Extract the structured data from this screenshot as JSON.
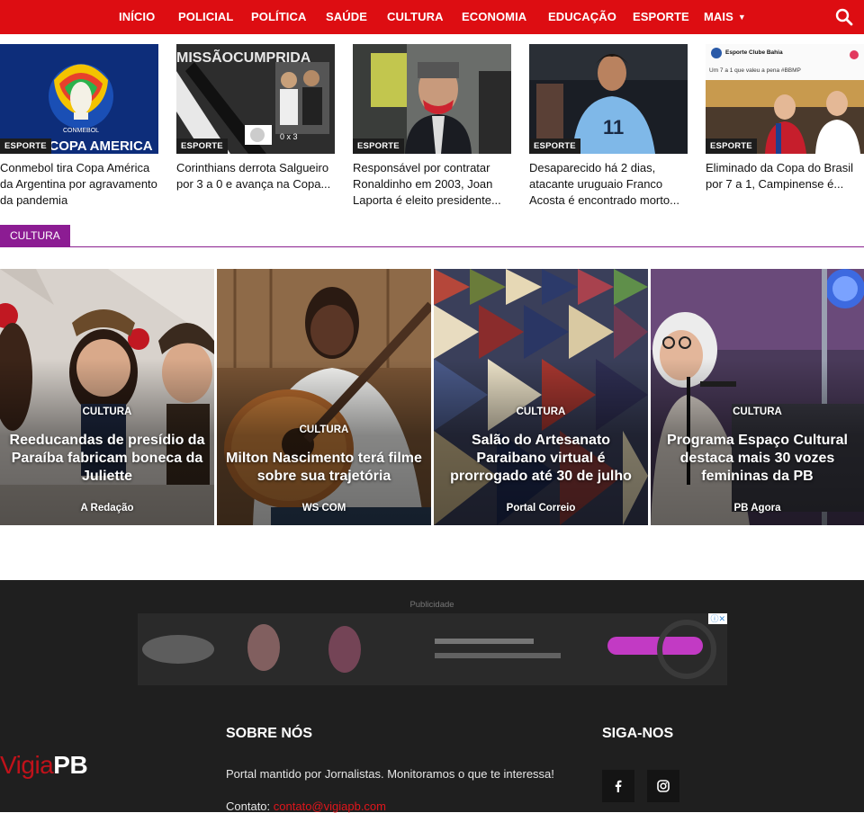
{
  "nav": {
    "items": [
      {
        "label": "INÍCIO"
      },
      {
        "label": "POLICIAL"
      },
      {
        "label": "POLÍTICA"
      },
      {
        "label": "SAÚDE"
      },
      {
        "label": "CULTURA"
      },
      {
        "label": "ECONOMIA"
      },
      {
        "label": "EDUCAÇÃO"
      },
      {
        "label": "ESPORTE"
      },
      {
        "label": "MAIS"
      }
    ],
    "more_icon": "chevron-down-icon",
    "search_icon": "search-icon",
    "bar_color": "#dd0d12"
  },
  "strip": [
    {
      "category": "ESPORTE",
      "title": "Conmebol tira Copa América da Argentina por agravamento da pandemia",
      "image_text_top": "CONMEBOL",
      "image_text": "COPA AMERICA"
    },
    {
      "category": "ESPORTE",
      "title": "Corinthians derrota Salgueiro por 3 a 0 e avança na Copa...",
      "image_text": "MISSÃOCUMPRIDA",
      "image_score": "0 x 3"
    },
    {
      "category": "ESPORTE",
      "title": "Responsável por contratar Ronaldinho em 2003, Joan Laporta é eleito presidente..."
    },
    {
      "category": "ESPORTE",
      "title": "Desaparecido há 2 dias, atacante uruguaio Franco Acosta é encontrado morto...",
      "image_number": "11"
    },
    {
      "category": "ESPORTE",
      "title": "Eliminado da Copa do Brasil por 7 a 1, Campinense é...",
      "image_account": "Esporte Clube Bahia",
      "image_caption": "Um 7 a 1 que valeu a pena #BBMP"
    }
  ],
  "section": {
    "label": "CULTURA",
    "color": "#8c1c93"
  },
  "features": [
    {
      "category": "CULTURA",
      "title": "Reeducandas de presídio da Paraíba fabricam boneca da Juliette",
      "source": "A Redação"
    },
    {
      "category": "CULTURA",
      "title": "Milton Nascimento terá filme sobre sua trajetória",
      "source": "WS COM"
    },
    {
      "category": "CULTURA",
      "title": "Salão do Artesanato Paraibano virtual é prorrogado até 30 de julho",
      "source": "Portal Correio"
    },
    {
      "category": "CULTURA",
      "title": "Programa Espaço Cultural destaca mais 30 vozes femininas da PB",
      "source": "PB Agora"
    }
  ],
  "footer": {
    "ad_label": "Publicidade",
    "ad_info": "ⓘ✕",
    "logo_red": "Vigia",
    "logo_white": "PB",
    "about_heading": "SOBRE NÓS",
    "about_text": "Portal mantido por Jornalistas. Monitoramos o que te interessa!",
    "contact_label": "Contato:",
    "contact_email": "contato@vigiapb.com",
    "follow_heading": "SIGA-NOS",
    "social": [
      {
        "icon": "facebook-icon"
      },
      {
        "icon": "instagram-icon"
      }
    ]
  }
}
